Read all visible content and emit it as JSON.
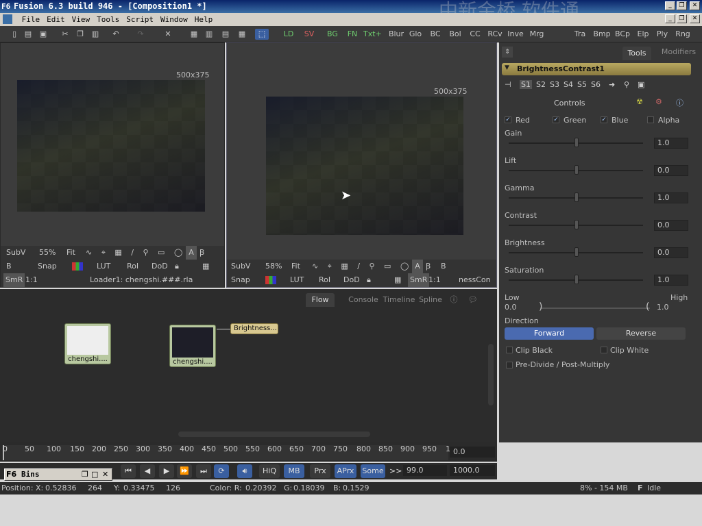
{
  "window": {
    "title": "Fusion 6.3 build 946 - [Composition1 *]",
    "app_icon": "F6",
    "watermark": "中新金桥 软件通"
  },
  "menu": [
    "File",
    "Edit",
    "View",
    "Tools",
    "Script",
    "Window",
    "Help"
  ],
  "toolbar": {
    "view_buttons": [
      "LD",
      "SV",
      "BG",
      "FN",
      "Txt+"
    ],
    "tool_buttons": [
      "Blur",
      "Glo",
      "BC",
      "Bol",
      "CC",
      "RCv",
      "Inve",
      "Mrg",
      "Tra",
      "Bmp",
      "BCp",
      "Elp",
      "Ply",
      "Rng"
    ]
  },
  "viewer_left": {
    "resolution": "500x375",
    "subv": "SubV",
    "zoom": "55%",
    "fit": "Fit",
    "row2": [
      "B",
      "Snap",
      "LUT",
      "RoI",
      "DoD"
    ],
    "smr": "SmR",
    "onetoone": "1:1",
    "loader_label": "Loader1: chengshi.###.rla"
  },
  "viewer_right": {
    "resolution": "500x375",
    "subv": "SubV",
    "zoom": "58%",
    "fit": "Fit",
    "row2": [
      "Snap",
      "LUT",
      "RoI",
      "DoD"
    ],
    "smr": "SmR",
    "onetoone": "1:1",
    "node_label": "nessCon"
  },
  "flow": {
    "tabs": [
      "Flow",
      "Console",
      "Timeline",
      "Spline"
    ],
    "nodes": [
      {
        "label": "chengshi...."
      },
      {
        "label": "chengshi...."
      },
      {
        "label": "Brightness..."
      }
    ]
  },
  "tools_panel": {
    "tabs": [
      "Tools",
      "Modifiers"
    ],
    "tool_name": "BrightnessContrast1",
    "sets": [
      "S1",
      "S2",
      "S3",
      "S4",
      "S5",
      "S6"
    ],
    "controls_label": "Controls",
    "channels": [
      {
        "label": "Red",
        "checked": true
      },
      {
        "label": "Green",
        "checked": true
      },
      {
        "label": "Blue",
        "checked": true
      },
      {
        "label": "Alpha",
        "checked": false
      }
    ],
    "sliders": [
      {
        "label": "Gain",
        "value": "1.0"
      },
      {
        "label": "Lift",
        "value": "0.0"
      },
      {
        "label": "Gamma",
        "value": "1.0"
      },
      {
        "label": "Contrast",
        "value": "0.0"
      },
      {
        "label": "Brightness",
        "value": "0.0"
      },
      {
        "label": "Saturation",
        "value": "1.0"
      }
    ],
    "range": {
      "low_label": "Low",
      "high_label": "High",
      "low_value": "0.0",
      "high_value": "1.0"
    },
    "direction": {
      "label": "Direction",
      "forward": "Forward",
      "reverse": "Reverse"
    },
    "clip_black": "Clip Black",
    "clip_white": "Clip White",
    "predivide": "Pre-Divide / Post-Multiply"
  },
  "timeline": {
    "ticks": [
      "0",
      "50",
      "100",
      "150",
      "200",
      "250",
      "300",
      "350",
      "400",
      "450",
      "500",
      "550",
      "600",
      "650",
      "700",
      "750",
      "800",
      "850",
      "900",
      "950",
      "1"
    ],
    "current_time": "0.0",
    "render_buttons": [
      "HiQ",
      "MB",
      "Prx",
      "APrx",
      "Some"
    ],
    "render_arrows": ">>",
    "start_value": "99.0",
    "end_value": "1000.0"
  },
  "bins": {
    "label": "Bins",
    "icon": "F6"
  },
  "status": {
    "position_label": "Position:",
    "x_label": "X:",
    "x_value": "0.52836",
    "x_px": "264",
    "y_label": "Y:",
    "y_value": "0.33475",
    "y_px": "126",
    "color_label": "Color: R:",
    "r_value": "0.20392",
    "g_label": "G:",
    "g_value": "0.18039",
    "b_label": "B:",
    "b_value": "0.1529",
    "memory": "8% - 154 MB",
    "state_icon": "F",
    "state": "Idle"
  }
}
